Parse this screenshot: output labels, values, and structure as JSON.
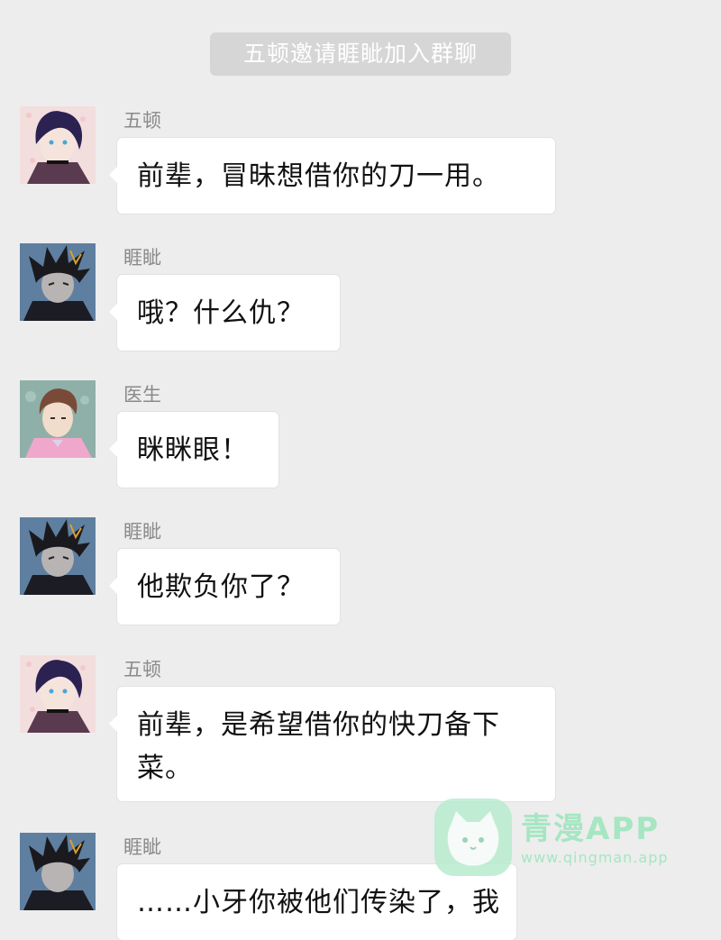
{
  "system_notice": "五顿邀请睚眦加入群聊",
  "messages": [
    {
      "sender": "五顿",
      "text": "前辈，冒昧想借你的刀一用。",
      "avatar_icon": "purple-hair-character-avatar"
    },
    {
      "sender": "睚眦",
      "text": "哦？什么仇？",
      "avatar_icon": "spiky-hair-character-avatar"
    },
    {
      "sender": "医生",
      "text": "眯眯眼！",
      "avatar_icon": "brown-hair-pink-suit-character-avatar"
    },
    {
      "sender": "睚眦",
      "text": "他欺负你了？",
      "avatar_icon": "spiky-hair-character-avatar"
    },
    {
      "sender": "五顿",
      "text": "前辈，是希望借你的快刀备下菜。",
      "avatar_icon": "purple-hair-character-avatar"
    },
    {
      "sender": "睚眦",
      "text": "……小牙你被他们传染了，我",
      "avatar_icon": "spiky-hair-character-avatar"
    }
  ],
  "watermark": {
    "title": "青漫APP",
    "url": "www.qingman.app",
    "icon": "cat-logo-icon",
    "color": "#a6e6c2"
  },
  "colors": {
    "background": "#ededed",
    "bubble": "#ffffff",
    "notice": "#d6d6d6"
  }
}
